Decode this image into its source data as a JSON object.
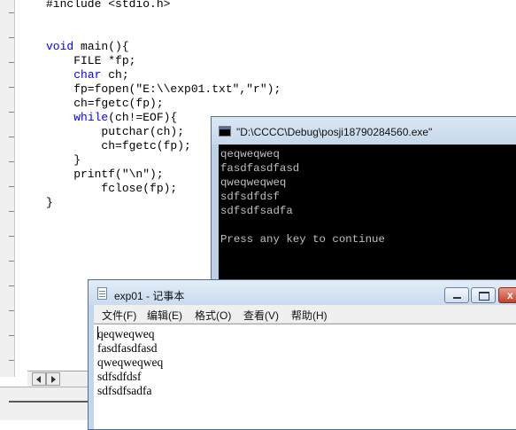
{
  "editor": {
    "code_lines": [
      [
        {
          "t": "#include <stdio.h>"
        }
      ],
      [
        {
          "t": ""
        }
      ],
      [
        {
          "t": ""
        }
      ],
      [
        {
          "t": "void",
          "k": true
        },
        {
          "t": " main(){"
        }
      ],
      [
        {
          "t": "    FILE *fp;"
        }
      ],
      [
        {
          "t": "    "
        },
        {
          "t": "char",
          "k": true
        },
        {
          "t": " ch;"
        }
      ],
      [
        {
          "t": "    fp=fopen(\"E:\\\\exp01.txt\",\"r\");"
        }
      ],
      [
        {
          "t": "    ch=fgetc(fp);"
        }
      ],
      [
        {
          "t": "    "
        },
        {
          "t": "while",
          "k": true
        },
        {
          "t": "(ch!=EOF){"
        }
      ],
      [
        {
          "t": "        putchar(ch);"
        }
      ],
      [
        {
          "t": "        ch=fgetc(fp);"
        }
      ],
      [
        {
          "t": "    }"
        }
      ],
      [
        {
          "t": "    printf(\"\\n\");"
        }
      ],
      [
        {
          "t": "        fclose(fp);"
        }
      ],
      [
        {
          "t": "}"
        }
      ]
    ]
  },
  "console": {
    "title": "\"D:\\CCCC\\Debug\\posji18790284560.exe\"",
    "lines": [
      "qeqweqweq",
      "fasdfasdfasd",
      "qweqweqweq",
      "sdfsdfdsf",
      "sdfsdfsadfa",
      "",
      "Press any key to continue"
    ]
  },
  "notepad": {
    "title": "exp01 - 记事本",
    "menu": [
      "文件(F)",
      "编辑(E)",
      "格式(O)",
      "查看(V)",
      "帮助(H)"
    ],
    "lines": [
      "qeqweqweq",
      "fasdfasdfasd",
      "qweqweqweq",
      "sdfsdfdsf",
      "sdfsdfsadfa"
    ],
    "close_glyph": "x"
  },
  "icons": {
    "console": "console-icon",
    "notepad": "notepad-icon"
  },
  "colors": {
    "keyword": "#0000ff",
    "console_bg": "#000000",
    "console_text": "#c0c0c0",
    "window_frame": "#c3d6ec",
    "close_button": "#c4412b"
  }
}
